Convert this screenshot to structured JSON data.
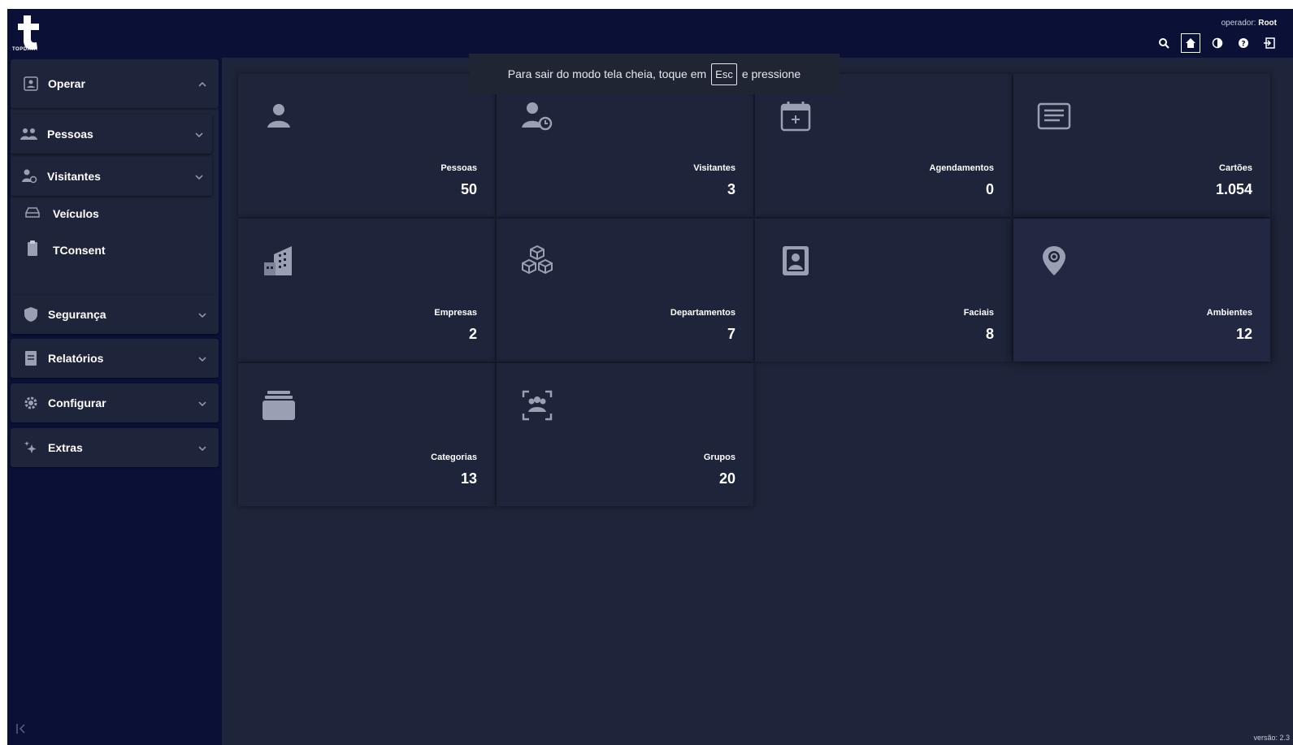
{
  "brand": {
    "name": "TOPDATA"
  },
  "header": {
    "operator_prefix": "operador:",
    "operator_name": "Root",
    "icons": [
      "search-icon",
      "home-icon",
      "contrast-icon",
      "help-icon",
      "logout-icon"
    ]
  },
  "toast": {
    "before": "Para sair do modo tela cheia, toque em",
    "key": "Esc",
    "after": "e pressione"
  },
  "sidebar": {
    "operar": {
      "label": "Operar",
      "icon": "operator-icon"
    },
    "pessoas": {
      "label": "Pessoas",
      "icon": "people-icon"
    },
    "visitantes": {
      "label": "Visitantes",
      "icon": "visitor-icon"
    },
    "veiculos": {
      "label": "Veículos",
      "icon": "car-icon"
    },
    "tconsent": {
      "label": "TConsent",
      "icon": "clipboard-icon"
    },
    "seguranca": {
      "label": "Segurança",
      "icon": "shield-icon"
    },
    "relatorios": {
      "label": "Relatórios",
      "icon": "report-icon"
    },
    "configurar": {
      "label": "Configurar",
      "icon": "gear-icon"
    },
    "extras": {
      "label": "Extras",
      "icon": "sparkle-icon"
    }
  },
  "cards": [
    {
      "label": "Pessoas",
      "value": "50",
      "icon": "person-icon"
    },
    {
      "label": "Visitantes",
      "value": "3",
      "icon": "visitor-icon"
    },
    {
      "label": "Agendamentos",
      "value": "0",
      "icon": "calendar-icon"
    },
    {
      "label": "Cartões",
      "value": "1.054",
      "icon": "card-list-icon"
    },
    {
      "label": "Empresas",
      "value": "2",
      "icon": "building-icon"
    },
    {
      "label": "Departamentos",
      "value": "7",
      "icon": "boxes-icon"
    },
    {
      "label": "Faciais",
      "value": "8",
      "icon": "face-badge-icon"
    },
    {
      "label": "Ambientes",
      "value": "12",
      "icon": "location-icon"
    },
    {
      "label": "Categorias",
      "value": "13",
      "icon": "folder-stack-icon"
    },
    {
      "label": "Grupos",
      "value": "20",
      "icon": "group-scan-icon"
    }
  ],
  "footer": {
    "version": "versão: 2.3"
  },
  "colors": {
    "background": "#0b1136",
    "panel": "#1e2439",
    "text": "#ffffff",
    "icon": "#9aa0b4"
  }
}
